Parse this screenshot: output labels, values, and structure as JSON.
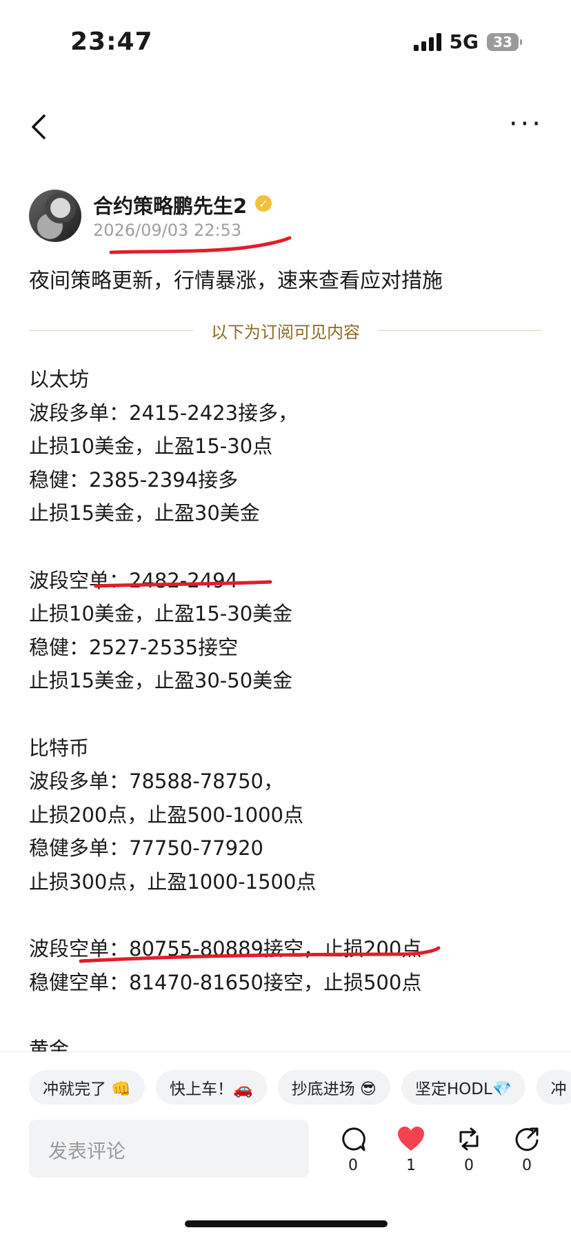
{
  "status": {
    "time": "23:47",
    "network": "5G",
    "battery": "33"
  },
  "author": {
    "name": "合约策略鹏先生2",
    "timestamp": "2026/09/03 22:53",
    "verified_icon": "verified-badge-icon"
  },
  "post": {
    "headline": "夜间策略更新，行情暴涨，速来查看应对措施",
    "divider_label": "以下为订阅可见内容",
    "lines": [
      "以太坊",
      "波段多单：2415-2423接多，",
      "止损10美金，止盈15-30点",
      "稳健：2385-2394接多",
      "止损15美金，止盈30美金",
      "",
      "波段空单：2482-2494",
      "止损10美金，止盈15-30美金",
      "稳健：2527-2535接空",
      "止损15美金，止盈30-50美金",
      "",
      "比特币",
      "波段多单：78588-78750，",
      "止损200点，止盈500-1000点",
      "稳健多单：77750-77920",
      "止损300点，止盈1000-1500点",
      "",
      "波段空单：80755-80889接空，止损200点",
      "稳健空单：81470-81650接空，止损500点",
      "",
      "黄金"
    ]
  },
  "quick_replies": [
    "冲就完了 👊",
    "快上车！🚗",
    "抄底进场 😎",
    "坚定HODL💎",
    "冲"
  ],
  "comment": {
    "placeholder": "发表评论"
  },
  "actions": {
    "comment_count": "0",
    "like_count": "1",
    "repost_count": "0",
    "share_count": "0"
  },
  "colors": {
    "accent_red": "#e21d2b",
    "divider_text": "#8b6b24",
    "like": "#f5424f"
  }
}
